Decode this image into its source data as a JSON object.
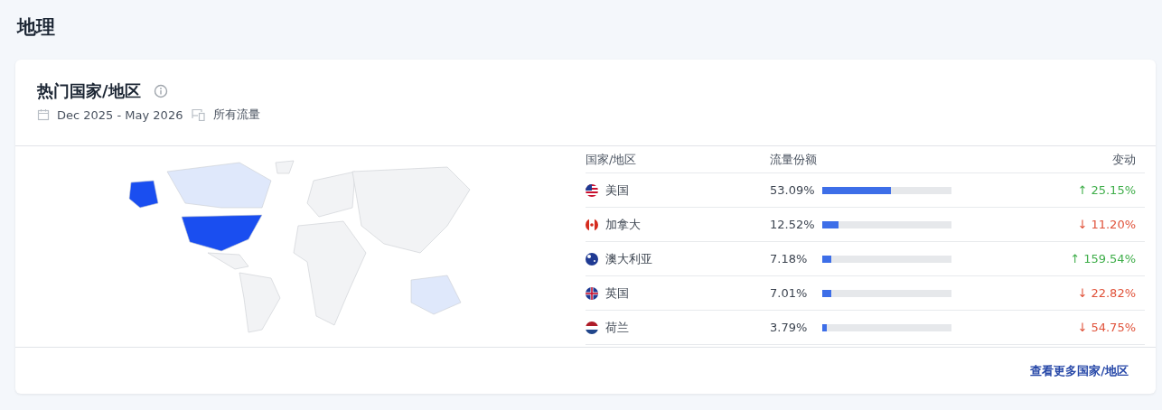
{
  "page_title": "地理",
  "card": {
    "title": "热门国家/地区",
    "date_range": "Dec 2025 - May 2026",
    "traffic_filter": "所有流量",
    "table": {
      "columns": [
        "国家/地区",
        "流量份额",
        "变动"
      ],
      "rows": [
        {
          "country": "美国",
          "share": "53.09%",
          "level": 0.531,
          "change": "↑ 25.15%",
          "increase": true
        },
        {
          "country": "加拿大",
          "share": "12.52%",
          "level": 0.125,
          "change": "↓ 11.20%",
          "increase": false
        },
        {
          "country": "澳大利亚",
          "share": "7.18%",
          "level": 0.072,
          "change": "↑ 159.54%",
          "increase": true
        },
        {
          "country": "英国",
          "share": "7.01%",
          "level": 0.07,
          "change": "↓ 22.82%",
          "increase": false
        },
        {
          "country": "荷兰",
          "share": "3.79%",
          "level": 0.038,
          "change": "↓ 54.75%",
          "increase": false
        }
      ]
    },
    "more_link": "查看更多国家/地区"
  }
}
